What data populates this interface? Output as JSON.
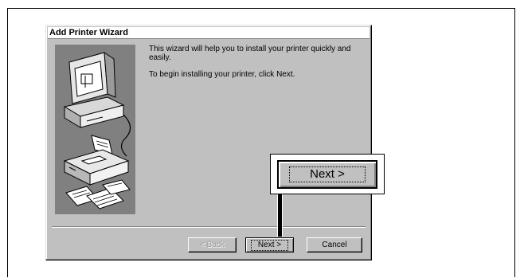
{
  "dialog": {
    "title": "Add Printer Wizard",
    "intro_line1": "This wizard will help you to install your printer quickly and easily.",
    "intro_line2": "To begin installing your printer, click Next."
  },
  "buttons": {
    "back_label": "< Back",
    "next_label": "Next >",
    "cancel_label": "Cancel"
  },
  "callout": {
    "next_label": "Next >"
  },
  "icons": [
    "computer-illustration",
    "printer-illustration",
    "printed-pages-illustration"
  ],
  "colors": {
    "dialog_face": "#c0c0c0",
    "illustration_bg": "#808080",
    "shadow": "#808080"
  }
}
